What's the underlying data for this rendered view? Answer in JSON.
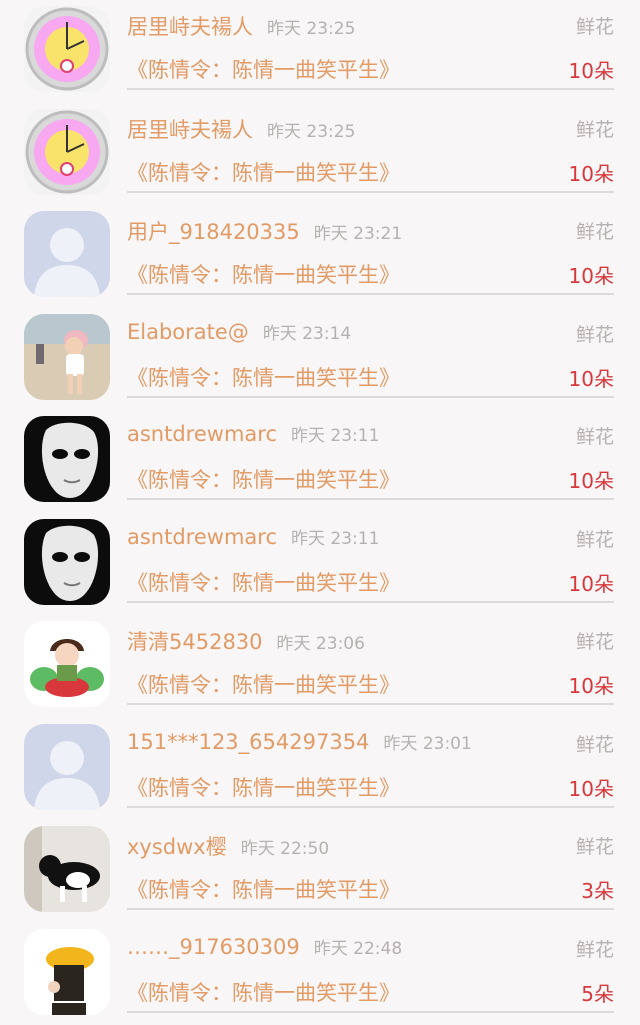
{
  "records": [
    {
      "avatar": "clock-flower-avatar",
      "username": "居里峙夫禓人",
      "time": "昨天 23:25",
      "gift_type": "鲜花",
      "title": "《陈情令：陈情一曲笑平生》",
      "count": "10朵"
    },
    {
      "avatar": "clock-flower-avatar",
      "username": "居里峙夫禓人",
      "time": "昨天 23:25",
      "gift_type": "鲜花",
      "title": "《陈情令：陈情一曲笑平生》",
      "count": "10朵"
    },
    {
      "avatar": "default-user-avatar",
      "username": "用户_918420335",
      "time": "昨天 23:21",
      "gift_type": "鲜花",
      "title": "《陈情令：陈情一曲笑平生》",
      "count": "10朵"
    },
    {
      "avatar": "child-beach-photo-avatar",
      "username": "Elaborate@",
      "time": "昨天 23:14",
      "gift_type": "鲜花",
      "title": "《陈情令：陈情一曲笑平生》",
      "count": "10朵"
    },
    {
      "avatar": "mask-avatar",
      "username": "asntdrewmarc",
      "time": "昨天 23:11",
      "gift_type": "鲜花",
      "title": "《陈情令：陈情一曲笑平生》",
      "count": "10朵"
    },
    {
      "avatar": "mask-avatar",
      "username": "asntdrewmarc",
      "time": "昨天 23:11",
      "gift_type": "鲜花",
      "title": "《陈情令：陈情一曲笑平生》",
      "count": "10朵"
    },
    {
      "avatar": "anime-character-avatar",
      "username": "清清5452830",
      "time": "昨天 23:06",
      "gift_type": "鲜花",
      "title": "《陈情令：陈情一曲笑平生》",
      "count": "10朵"
    },
    {
      "avatar": "default-user-avatar",
      "username": "151***123_654297354",
      "time": "昨天 23:01",
      "gift_type": "鲜花",
      "title": "《陈情令：陈情一曲笑平生》",
      "count": "10朵"
    },
    {
      "avatar": "cat-photo-avatar",
      "username": "xysdwx樱",
      "time": "昨天 22:50",
      "gift_type": "鲜花",
      "title": "《陈情令：陈情一曲笑平生》",
      "count": "3朵"
    },
    {
      "avatar": "yellow-hat-person-avatar",
      "username": "……_917630309",
      "time": "昨天 22:48",
      "gift_type": "鲜花",
      "title": "《陈情令：陈情一曲笑平生》",
      "count": "5朵"
    }
  ]
}
